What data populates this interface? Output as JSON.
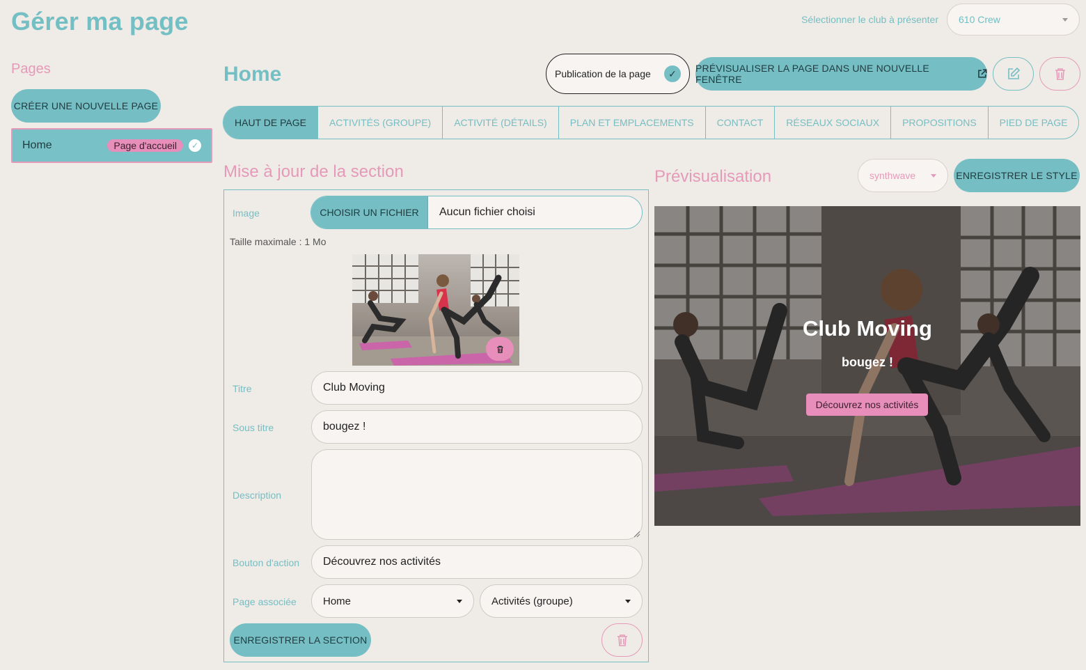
{
  "header": {
    "title": "Gérer ma page",
    "club_label": "Sélectionner le club à présenter",
    "club_value": "610 Crew"
  },
  "sidebar": {
    "title": "Pages",
    "create_label": "CRÉER UNE NOUVELLE PAGE",
    "items": [
      {
        "label": "Home",
        "badge": "Page d'accueil"
      }
    ]
  },
  "page": {
    "title": "Home",
    "publish_label": "Publication de la page",
    "preview_label": "PRÉVISUALISER LA PAGE DANS UNE NOUVELLE FENÊTRE"
  },
  "tabs": [
    {
      "label": "HAUT DE PAGE",
      "active": true
    },
    {
      "label": "ACTIVITÉS (GROUPE)"
    },
    {
      "label": "ACTIVITÉ (DÉTAILS)"
    },
    {
      "label": "PLAN ET EMPLACEMENTS"
    },
    {
      "label": "CONTACT"
    },
    {
      "label": "RÉSEAUX SOCIAUX"
    },
    {
      "label": "PROPOSITIONS"
    },
    {
      "label": "PIED DE PAGE"
    }
  ],
  "form": {
    "title": "Mise à jour de la section",
    "image_label": "Image",
    "file_button": "CHOISIR UN FICHIER",
    "file_status": "Aucun fichier choisi",
    "size_note": "Taille maximale : 1 Mo",
    "titre_label": "Titre",
    "titre_value": "Club Moving",
    "sous_titre_label": "Sous titre",
    "sous_titre_value": "bougez !",
    "description_label": "Description",
    "description_value": "",
    "bouton_label": "Bouton d'action",
    "bouton_value": "Découvrez nos activités",
    "page_assoc_label": "Page associée",
    "page_assoc_value": "Home",
    "section_assoc_value": "Activités (groupe)",
    "save_label": "ENREGISTRER LA SECTION"
  },
  "preview": {
    "title": "Prévisualisation",
    "style_value": "synthwave",
    "save_style_label": "ENREGISTRER LE STYLE",
    "hero_title": "Club Moving",
    "hero_subtitle": "bougez !",
    "hero_button": "Découvrez nos activités"
  },
  "colors": {
    "accent": "#75bec3",
    "secondary": "#e59ab9",
    "background": "#efebe7"
  }
}
